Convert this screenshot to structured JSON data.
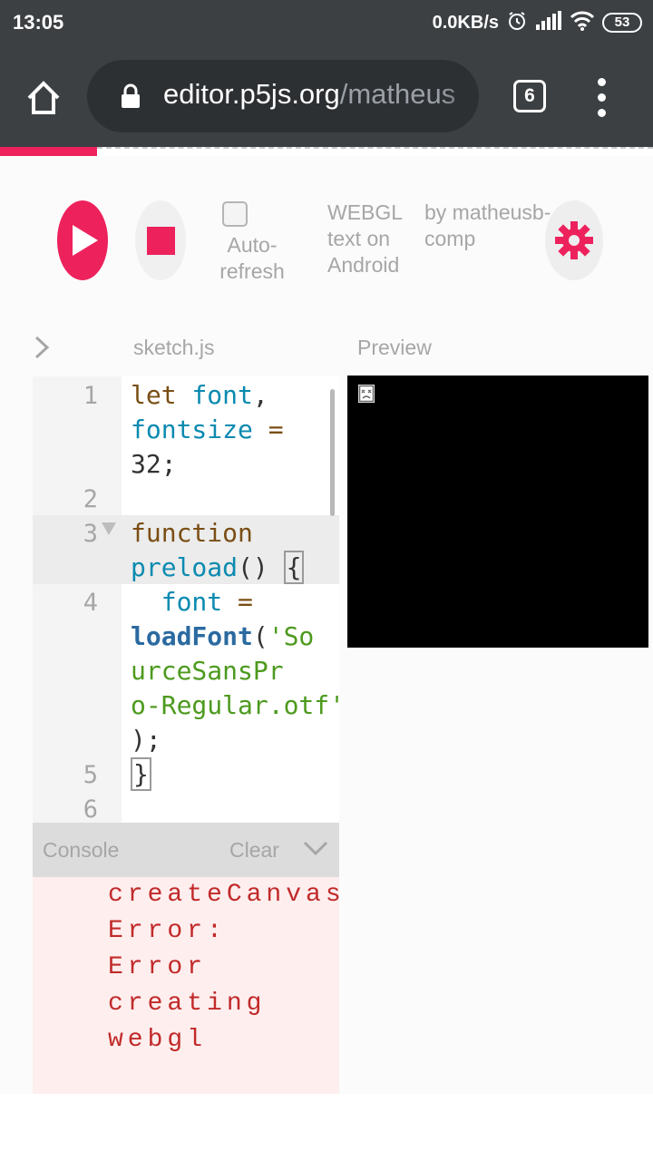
{
  "status_bar": {
    "time": "13:05",
    "network_speed": "0.0KB/s",
    "battery": "53",
    "icons": [
      "alarm-icon",
      "signal-icon",
      "wifi-icon",
      "battery-icon"
    ]
  },
  "browser": {
    "url_host": "editor.p5js.org",
    "url_path": "/matheus",
    "tab_count": "6",
    "icons": [
      "home-icon",
      "lock-icon",
      "more-vert-icon"
    ]
  },
  "toolbar": {
    "auto_refresh_label": "Auto-\nrefresh",
    "auto_refresh_checked": false,
    "project_title": "WEBGL text on Android",
    "project_owner": "by matheusb-comp",
    "icons": [
      "play-icon",
      "stop-icon",
      "gear-icon"
    ]
  },
  "editor": {
    "file_name": "sketch.js",
    "preview_label": "Preview",
    "line_numbers": [
      "1",
      "2",
      "3",
      "4",
      "5",
      "6"
    ],
    "code": {
      "line1_kw": "let",
      "line1_var1": "font",
      "line1_comma": ",",
      "line1_var2": "fontsize",
      "line1_eq": "=",
      "line1_num": "32;",
      "line3_kw": "function",
      "line3_fn": "preload",
      "line3_parens": "()",
      "line3_brace": "{",
      "line4_var": "font",
      "line4_eq": "=",
      "line4_fn": "loadFont",
      "line4_paren": "(",
      "line4_str": "'SourceSansPro-Regular.otf'",
      "line4_end": ");",
      "line5_brace": "}"
    }
  },
  "console": {
    "title": "Console",
    "clear_label": "Clear",
    "message": "createCanvas: Error: Error creating webgl"
  },
  "colors": {
    "accent": "#ed225d",
    "chrome": "#3c4043",
    "console_bg": "#ffeeee",
    "error_text": "#c12a2a"
  }
}
